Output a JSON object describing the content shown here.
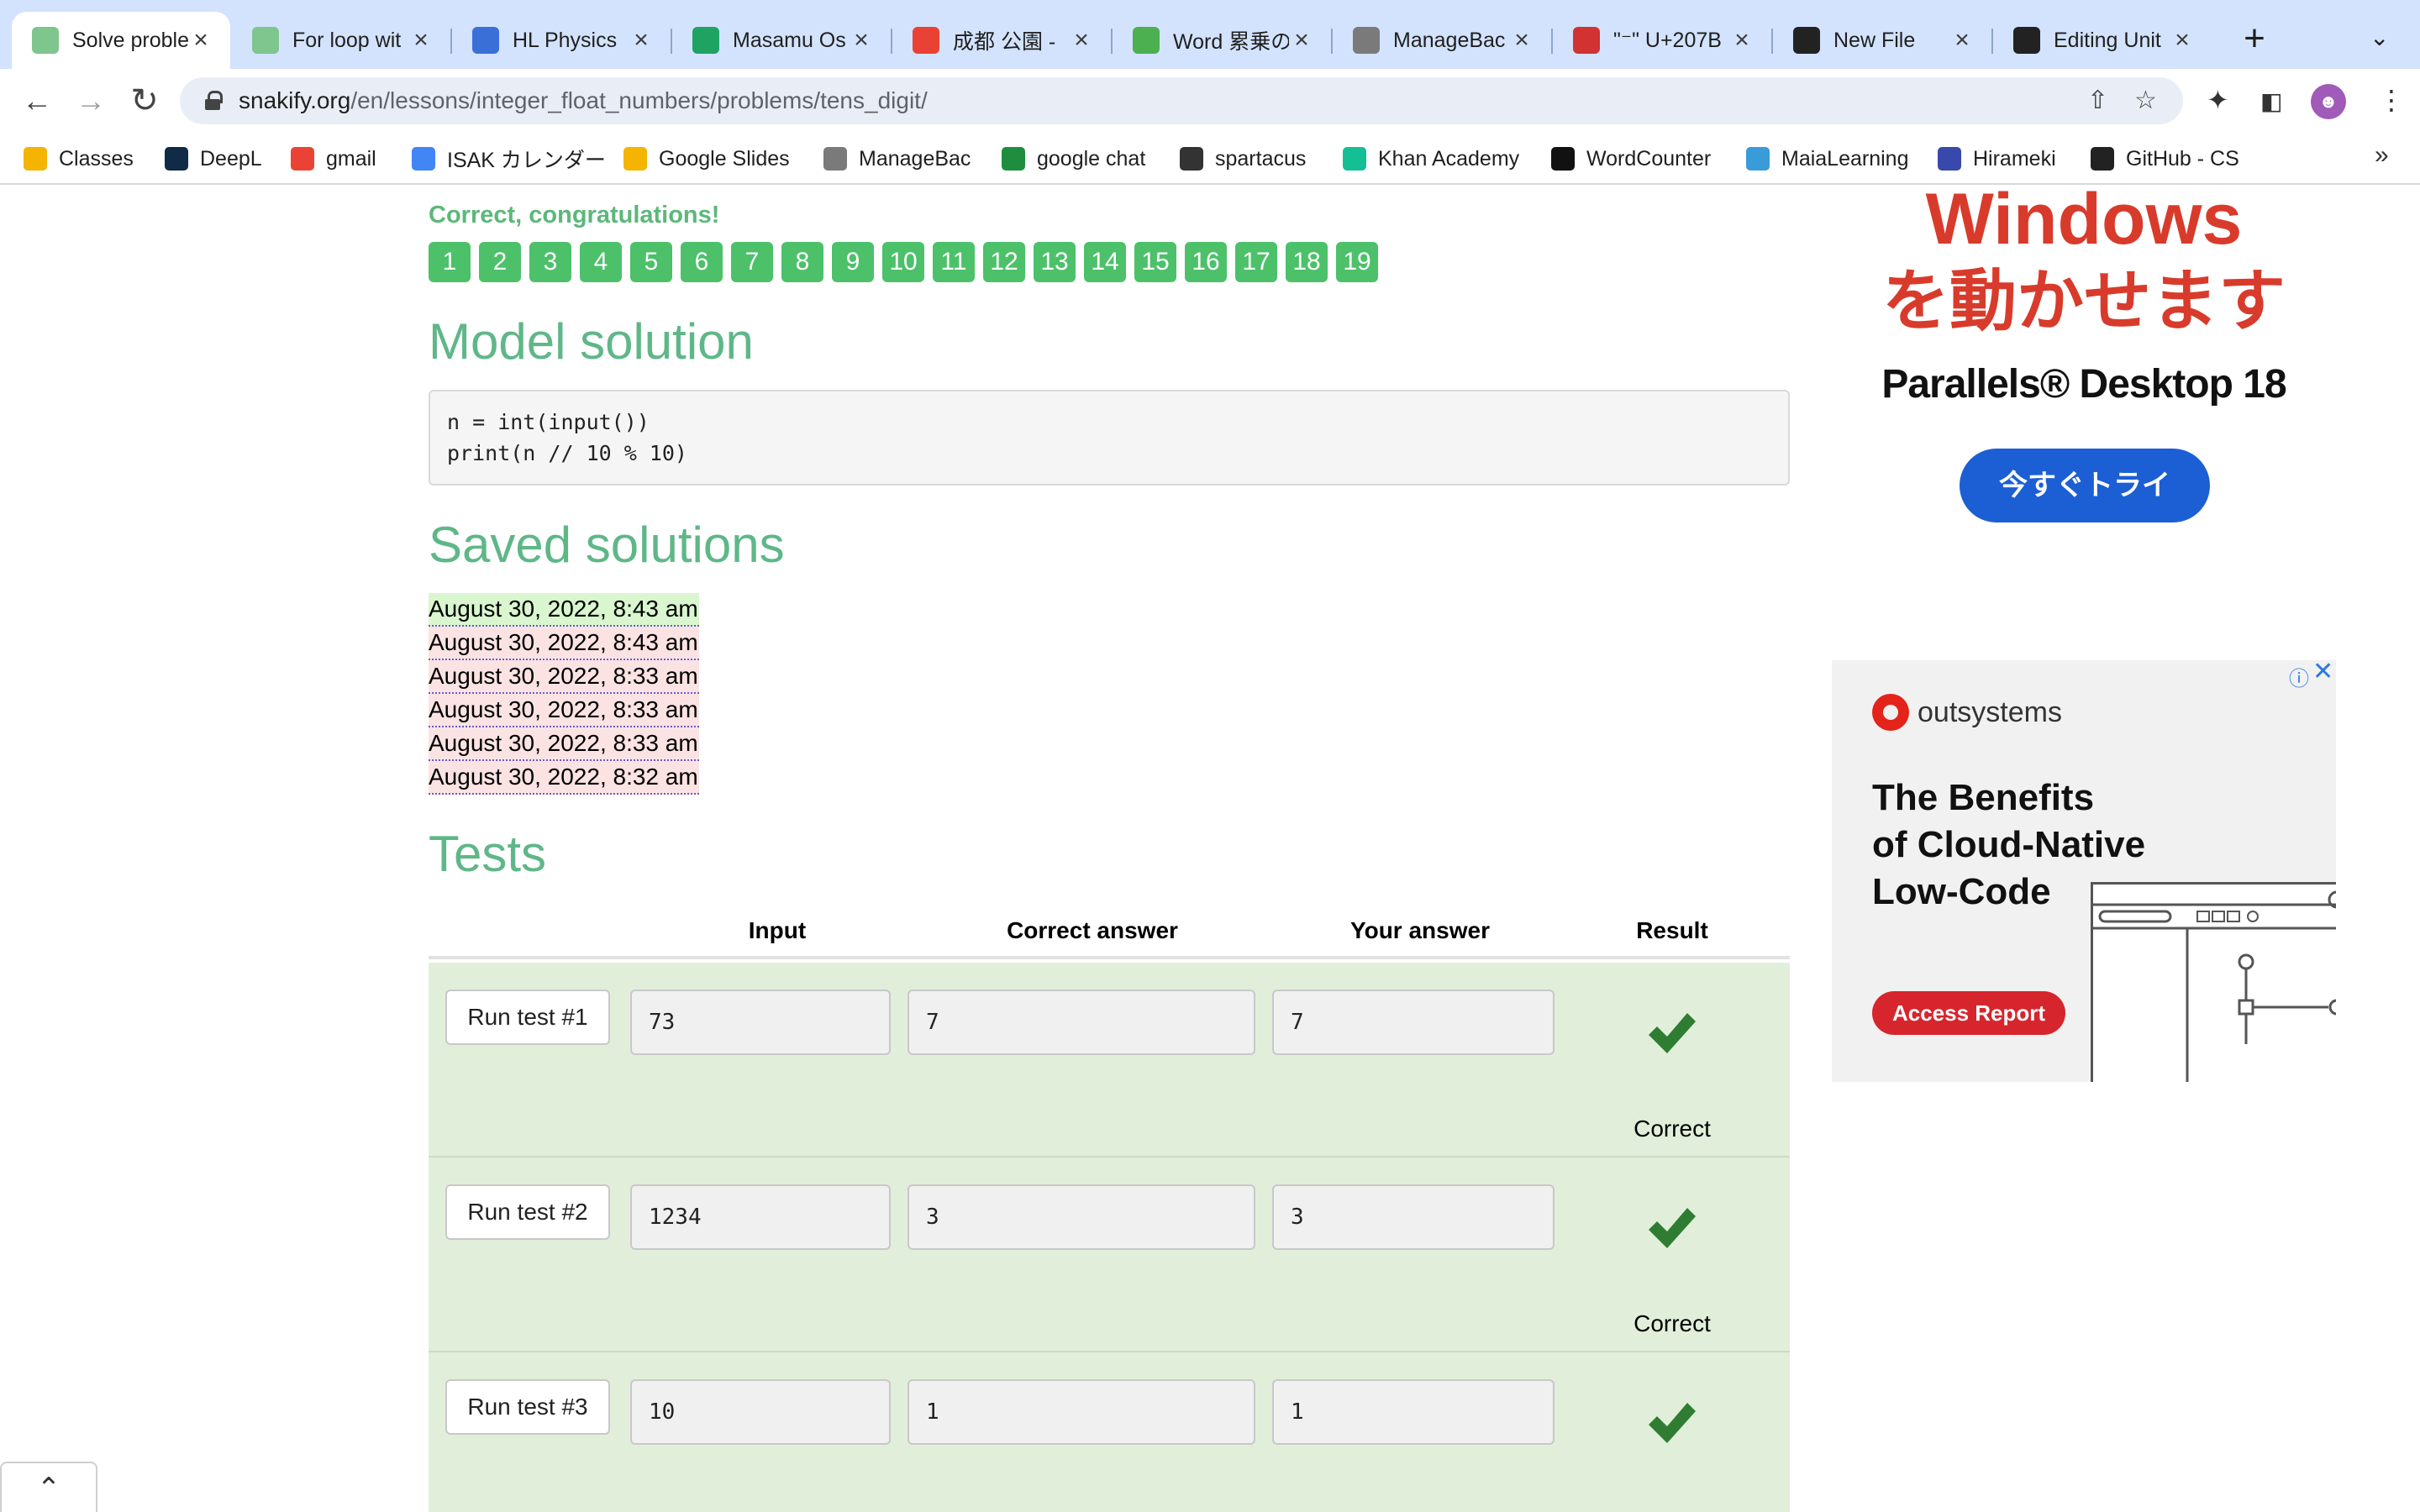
{
  "browser": {
    "tabs": [
      {
        "title": "Solve proble",
        "icon": "snakify-icon",
        "color": "#7fc58e",
        "active": true
      },
      {
        "title": "For loop wit",
        "icon": "snakify-icon",
        "color": "#7fc58e"
      },
      {
        "title": "HL Physics",
        "icon": "classroom-icon",
        "color": "#3b6fd8"
      },
      {
        "title": "Masamu Os",
        "icon": "sheets-icon",
        "color": "#1ea362"
      },
      {
        "title": "成都 公園 -",
        "icon": "maps-pin-icon",
        "color": "#e94235"
      },
      {
        "title": "Word 累乗の",
        "icon": "word-icon",
        "color": "#4caf50"
      },
      {
        "title": "ManageBac",
        "icon": "managebac-icon",
        "color": "#7a7a7a"
      },
      {
        "title": "\"⁻\" U+207B",
        "icon": "unicode-icon",
        "color": "#d23232"
      },
      {
        "title": "New File",
        "icon": "github-icon",
        "color": "#222222"
      },
      {
        "title": "Editing Unit",
        "icon": "github-icon",
        "color": "#222222"
      }
    ],
    "url_host": "snakify.org",
    "url_path": "/en/lessons/integer_float_numbers/problems/tens_digit/",
    "bookmarks": [
      {
        "label": "Classes",
        "icon": "classroom-icon",
        "color": "#f4b400"
      },
      {
        "label": "DeepL",
        "icon": "deepl-icon",
        "color": "#0f2b46"
      },
      {
        "label": "gmail",
        "icon": "gmail-icon",
        "color": "#ea4335"
      },
      {
        "label": "ISAK カレンダー",
        "icon": "calendar-icon",
        "color": "#4285f4"
      },
      {
        "label": "Google Slides",
        "icon": "slides-icon",
        "color": "#f4b400"
      },
      {
        "label": "ManageBac",
        "icon": "managebac-icon",
        "color": "#7a7a7a"
      },
      {
        "label": "google chat",
        "icon": "chat-icon",
        "color": "#1e8e3e"
      },
      {
        "label": "spartacus",
        "icon": "spartacus-icon",
        "color": "#333333"
      },
      {
        "label": "Khan Academy",
        "icon": "khan-icon",
        "color": "#14bf96"
      },
      {
        "label": "WordCounter",
        "icon": "wordcounter-icon",
        "color": "#111111"
      },
      {
        "label": "MaiaLearning",
        "icon": "maia-icon",
        "color": "#3a9bd9"
      },
      {
        "label": "Hirameki",
        "icon": "hirameki-icon",
        "color": "#3949ab"
      },
      {
        "label": "GitHub - CS",
        "icon": "github-icon",
        "color": "#222222"
      }
    ]
  },
  "page": {
    "congrats": "Correct, congratulations!",
    "problem_numbers": [
      "1",
      "2",
      "3",
      "4",
      "5",
      "6",
      "7",
      "8",
      "9",
      "10",
      "11",
      "12",
      "13",
      "14",
      "15",
      "16",
      "17",
      "18",
      "19"
    ],
    "model_title": "Model solution",
    "model_code": "n = int(input())\nprint(n // 10 % 10)",
    "saved_title": "Saved solutions",
    "saved": [
      {
        "time": "August 30, 2022, 8:43 am",
        "status": "ok"
      },
      {
        "time": "August 30, 2022, 8:43 am",
        "status": "bad"
      },
      {
        "time": "August 30, 2022, 8:33 am",
        "status": "bad"
      },
      {
        "time": "August 30, 2022, 8:33 am",
        "status": "bad"
      },
      {
        "time": "August 30, 2022, 8:33 am",
        "status": "bad"
      },
      {
        "time": "August 30, 2022, 8:32 am",
        "status": "bad"
      }
    ],
    "tests_title": "Tests",
    "columns": {
      "input": "Input",
      "correct": "Correct answer",
      "yours": "Your answer",
      "result": "Result"
    },
    "tests": [
      {
        "button": "Run test #1",
        "input": "73",
        "correct": "7",
        "yours": "7",
        "result": "Correct"
      },
      {
        "button": "Run test #2",
        "input": "1234",
        "correct": "3",
        "yours": "3",
        "result": "Correct"
      },
      {
        "button": "Run test #3",
        "input": "10",
        "correct": "1",
        "yours": "1",
        "result": ""
      }
    ]
  },
  "ads": {
    "parallels_line1": "Windows",
    "parallels_line2": "を動かせます",
    "parallels_product": "Parallels® Desktop 18",
    "parallels_cta": "今すぐトライ",
    "outsystems_brand": "outsystems",
    "outsystems_headline": "The Benefits\nof Cloud-Native\nLow-Code",
    "outsystems_cta": "Access Report"
  },
  "colors": {
    "accent_green": "#5fb788",
    "badge_green": "#4cc16a",
    "test_row_bg": "#e1efda",
    "check_green": "#2e7d32"
  }
}
